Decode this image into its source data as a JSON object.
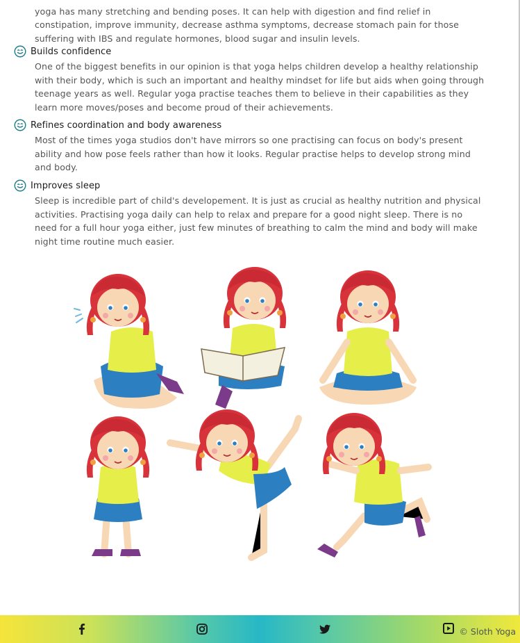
{
  "intro": {
    "text": "yoga has many stretching and bending poses. It can help with digestion and find relief in constipation, improve immunity, decrease asthma symptoms, decrease stomach pain for those suffering with IBS and regulate hormones, blood sugar and insulin levels."
  },
  "benefits": [
    {
      "icon": "smiley-icon",
      "title": "Builds confidence",
      "text": "One of the biggest benefits in our opinion is that yoga helps children develop a healthy relationship with their body, which is such an important and healthy mindset for life but aids when going through teenage years as well. Regular yoga practise teaches them to believe in their capabilities as they learn more moves/poses and become proud of their achievements."
    },
    {
      "icon": "smiley-icon",
      "title": "Refines coordination and body awareness",
      "text": "Most of the times yoga studios don't have mirrors so one practising can focus on body's present ability and how pose feels rather than how it looks. Regular practise helps to develop strong mind and body."
    },
    {
      "icon": "smiley-icon",
      "title": "Improves sleep",
      "text": "Sleep is incredible part of child's developement. It is just as crucial as healthy nutrition and physical activities. Practising yoga daily can help to relax and prepare for a good night sleep. There is no need for a full hour yoga either, just few minutes of breathing to calm the mind and body will make night time routine much easier."
    }
  ],
  "colors": {
    "icon": "#1f7e8c",
    "hair": "#d8323b",
    "shirt": "#e6ef4a",
    "skirt": "#2c7fc0",
    "skin": "#f8d7b4",
    "shoes": "#7b3a8a"
  },
  "footer": {
    "icons": [
      "facebook-icon",
      "instagram-icon",
      "twitter-icon",
      "youtube-icon"
    ],
    "copyright": "© Sloth Yoga"
  }
}
